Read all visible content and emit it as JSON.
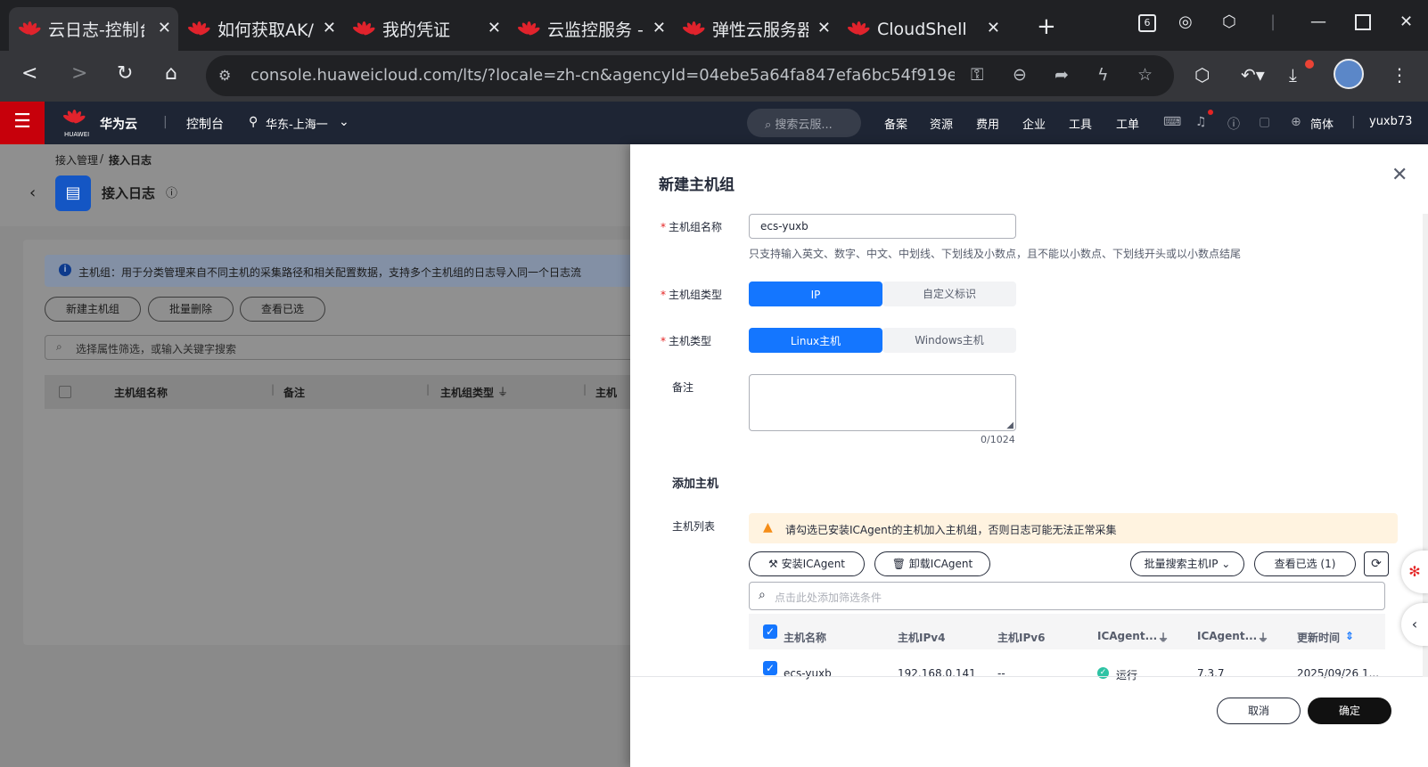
{
  "browser": {
    "tabs": [
      {
        "label": "云日志-控制台"
      },
      {
        "label": "如何获取AK/"
      },
      {
        "label": "我的凭证"
      },
      {
        "label": "云监控服务 -"
      },
      {
        "label": "弹性云服务器"
      },
      {
        "label": "CloudShell"
      }
    ],
    "url": "console.huaweicloud.com/lts/?locale=zh-cn&agencyId=04ebe5a64fa847efa6bc54f919e93...",
    "tab_count": "6"
  },
  "header": {
    "brand": "华为云",
    "brand_sub": "HUAWEI",
    "console": "控制台",
    "region": "华东-上海一",
    "search_placeholder": "搜索云服...",
    "nav": [
      "备案",
      "资源",
      "费用",
      "企业",
      "工具",
      "工单"
    ],
    "lang": "简体",
    "user": "yuxb73"
  },
  "page": {
    "breadcrumb_parent": "接入管理",
    "breadcrumb_sep": "/",
    "breadcrumb_current": "接入日志",
    "title": "接入日志",
    "info_text": "主机组：用于分类管理来自不同主机的采集路径和相关配置数据，支持多个主机组的日志导入同一个日志流",
    "btn_new": "新建主机组",
    "btn_batch_delete": "批量删除",
    "btn_view_selected": "查看已选",
    "filter_placeholder": "选择属性筛选，或输入关键字搜索",
    "columns": [
      "主机组名称",
      "备注",
      "主机组类型",
      "主机"
    ]
  },
  "drawer": {
    "title": "新建主机组",
    "name_label": "主机组名称",
    "name_value": "ecs-yuxb",
    "name_hint": "只支持输入英文、数字、中文、中划线、下划线及小数点，且不能以小数点、下划线开头或以小数点结尾",
    "group_type_label": "主机组类型",
    "group_type_options": [
      "IP",
      "自定义标识"
    ],
    "host_type_label": "主机类型",
    "host_type_options": [
      "Linux主机",
      "Windows主机"
    ],
    "remark_label": "备注",
    "remark_counter": "0/1024",
    "add_host_title": "添加主机",
    "host_list_label": "主机列表",
    "warning": "请勾选已安装ICAgent的主机加入主机组，否则日志可能无法正常采集",
    "btn_install": "安装ICAgent",
    "btn_uninstall": "卸载ICAgent",
    "btn_batch_search": "批量搜索主机IP",
    "btn_view_selected": "查看已选 (1)",
    "table_filter_placeholder": "点击此处添加筛选条件",
    "table_columns": [
      "主机名称",
      "主机IPv4",
      "主机IPv6",
      "ICAgent...",
      "ICAgent...",
      "更新时间"
    ],
    "rows": [
      {
        "name": "ecs-yuxb",
        "ipv4": "192.168.0.141",
        "ipv6": "--",
        "status": "运行",
        "version": "7.3.7",
        "updated": "2025/09/26 1..."
      }
    ],
    "cancel": "取消",
    "confirm": "确定"
  },
  "colors": {
    "primary": "#1476ff",
    "brand_red": "#c7000b",
    "header_bg": "#1e2534",
    "warning_bg": "#fff3e0",
    "success": "#2ec3a4"
  }
}
